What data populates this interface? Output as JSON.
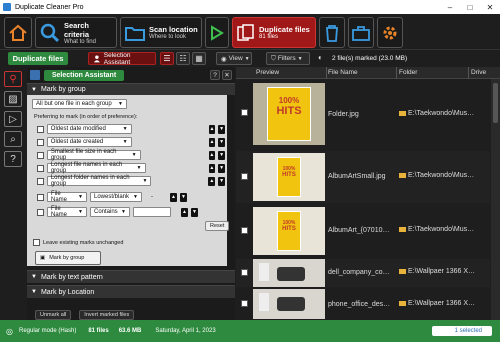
{
  "window": {
    "title": "Duplicate Cleaner Pro"
  },
  "toolbar": {
    "search_title": "Search criteria",
    "search_sub": "What to find",
    "scan_title": "Scan location",
    "scan_sub": "Where to look",
    "dup_title": "Duplicate files",
    "dup_sub": "81 files"
  },
  "subbar": {
    "duplicate_files_label": "Duplicate files",
    "selection_assistant_label": "Selection Assistant",
    "view_label": "View",
    "filters_label": "Filters",
    "marked_text": "2 file(s) marked (23.0 MB)"
  },
  "assistant": {
    "title": "Selection Assistant",
    "help": "?",
    "mark_by_group": "Mark by group",
    "group_option": "All but one file in each group",
    "preferring_label": "Preferring to mark (in order of preference):",
    "prefs": [
      "Oldest date modified",
      "Oldest date created",
      "Smallest file size in each group",
      "Longest file names in each group",
      "Longest folder names in each group"
    ],
    "filter1_field": "File Name",
    "filter1_op": "Lowest/blank",
    "filter2_field": "File Name",
    "filter2_op": "Contains",
    "reset_label": "Reset",
    "leave_existing": "Leave existing marks unchanged",
    "mark_by_group_button": "Mark by group",
    "mark_by_text": "Mark by text pattern",
    "mark_by_location": "Mark by Location",
    "unmark_all": "Unmark all",
    "invert_marked": "Invert marked files"
  },
  "grid": {
    "columns": [
      "Preview",
      "File Name",
      "Folder",
      "Drive"
    ],
    "rows": [
      {
        "name": "Folder.jpg",
        "folder": "E:\\Taekwondo\\Mus…",
        "thumb": "album"
      },
      {
        "name": "AlbumArtSmall.jpg",
        "folder": "E:\\Taekwondo\\Mus…",
        "thumb": "album"
      },
      {
        "name": "AlbumArt_{07010…",
        "folder": "E:\\Taekwondo\\Mus…",
        "thumb": "album"
      },
      {
        "name": "dell_company_co…",
        "folder": "E:\\Wallpaer 1366 X…",
        "thumb": "phone"
      },
      {
        "name": "phone_office_des…",
        "folder": "E:\\Wallpaer 1366 X…",
        "thumb": "phone"
      }
    ],
    "album_caption_top": "100%",
    "album_caption_big": "HITS"
  },
  "status": {
    "mode": "Regular mode (Hash)",
    "files": "81 files",
    "size": "63.6 MB",
    "date": "Saturday, April 1, 2023",
    "selected": "1 selected"
  },
  "colors": {
    "accent_green": "#2d8a3e",
    "accent_red": "#a01818"
  }
}
